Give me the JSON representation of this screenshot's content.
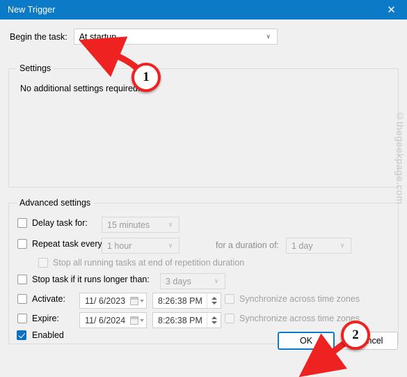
{
  "window": {
    "title": "New Trigger",
    "close_icon": "close-icon",
    "accent_color": "#0c7ac7"
  },
  "begin": {
    "label": "Begin the task:",
    "value": "At startup",
    "chevron": "∨"
  },
  "settings": {
    "legend": "Settings",
    "note": "No additional settings required."
  },
  "advanced": {
    "legend": "Advanced settings",
    "delay": {
      "label": "Delay task for:",
      "checked": false,
      "value": "15 minutes",
      "chevron": "∨"
    },
    "repeat": {
      "label": "Repeat task every:",
      "checked": false,
      "value": "1 hour",
      "chevron": "∨",
      "duration_label": "for a duration of:",
      "duration_value": "1 day",
      "duration_chevron": "∨"
    },
    "stop_all": {
      "label": "Stop all running tasks at end of repetition duration",
      "checked": false
    },
    "stop_longer": {
      "label": "Stop task if it runs longer than:",
      "checked": false,
      "value": "3 days",
      "chevron": "∨"
    },
    "activate": {
      "label": "Activate:",
      "checked": false,
      "date": "11/  6/2023",
      "time": "8:26:38 PM",
      "sync_label": "Synchronize across time zones",
      "sync_checked": false
    },
    "expire": {
      "label": "Expire:",
      "checked": false,
      "date": "11/  6/2024",
      "time": "8:26:38 PM",
      "sync_label": "Synchronize across time zones",
      "sync_checked": false
    }
  },
  "enabled": {
    "label": "Enabled",
    "checked": true
  },
  "buttons": {
    "ok": "OK",
    "cancel": "Cancel"
  },
  "watermark": "©thegeekpage.com",
  "annotations": {
    "step_one": "1",
    "step_two": "2",
    "color": "#ef2222"
  }
}
